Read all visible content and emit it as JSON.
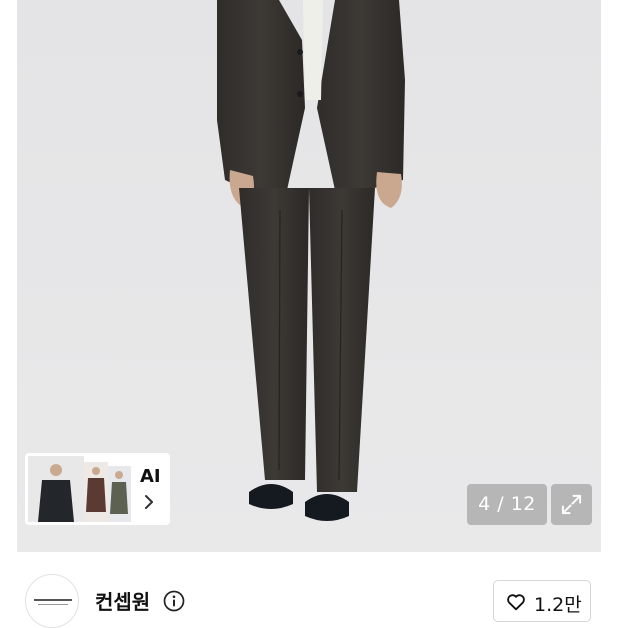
{
  "gallery": {
    "image_alt": "Model wearing charcoal suit jacket and wide pants with black sandals",
    "current_page": "4",
    "total_pages": "12",
    "page_separator": "/",
    "counter_text": "4 / 12"
  },
  "ai_recommendation": {
    "label": "AI",
    "icons": {
      "chevron": "chevron-right-icon"
    }
  },
  "expand": {
    "icon": "expand-arrows-icon"
  },
  "seller": {
    "name": "컨셉원",
    "logo_icon": "concept-one-logo",
    "info_icon": "info-circle-icon"
  },
  "like": {
    "count": "1.2만",
    "icon": "heart-outline-icon"
  },
  "colors": {
    "gallery_bg": "#e6e6e8",
    "overlay": "#8c8c8c",
    "text": "#111111"
  }
}
